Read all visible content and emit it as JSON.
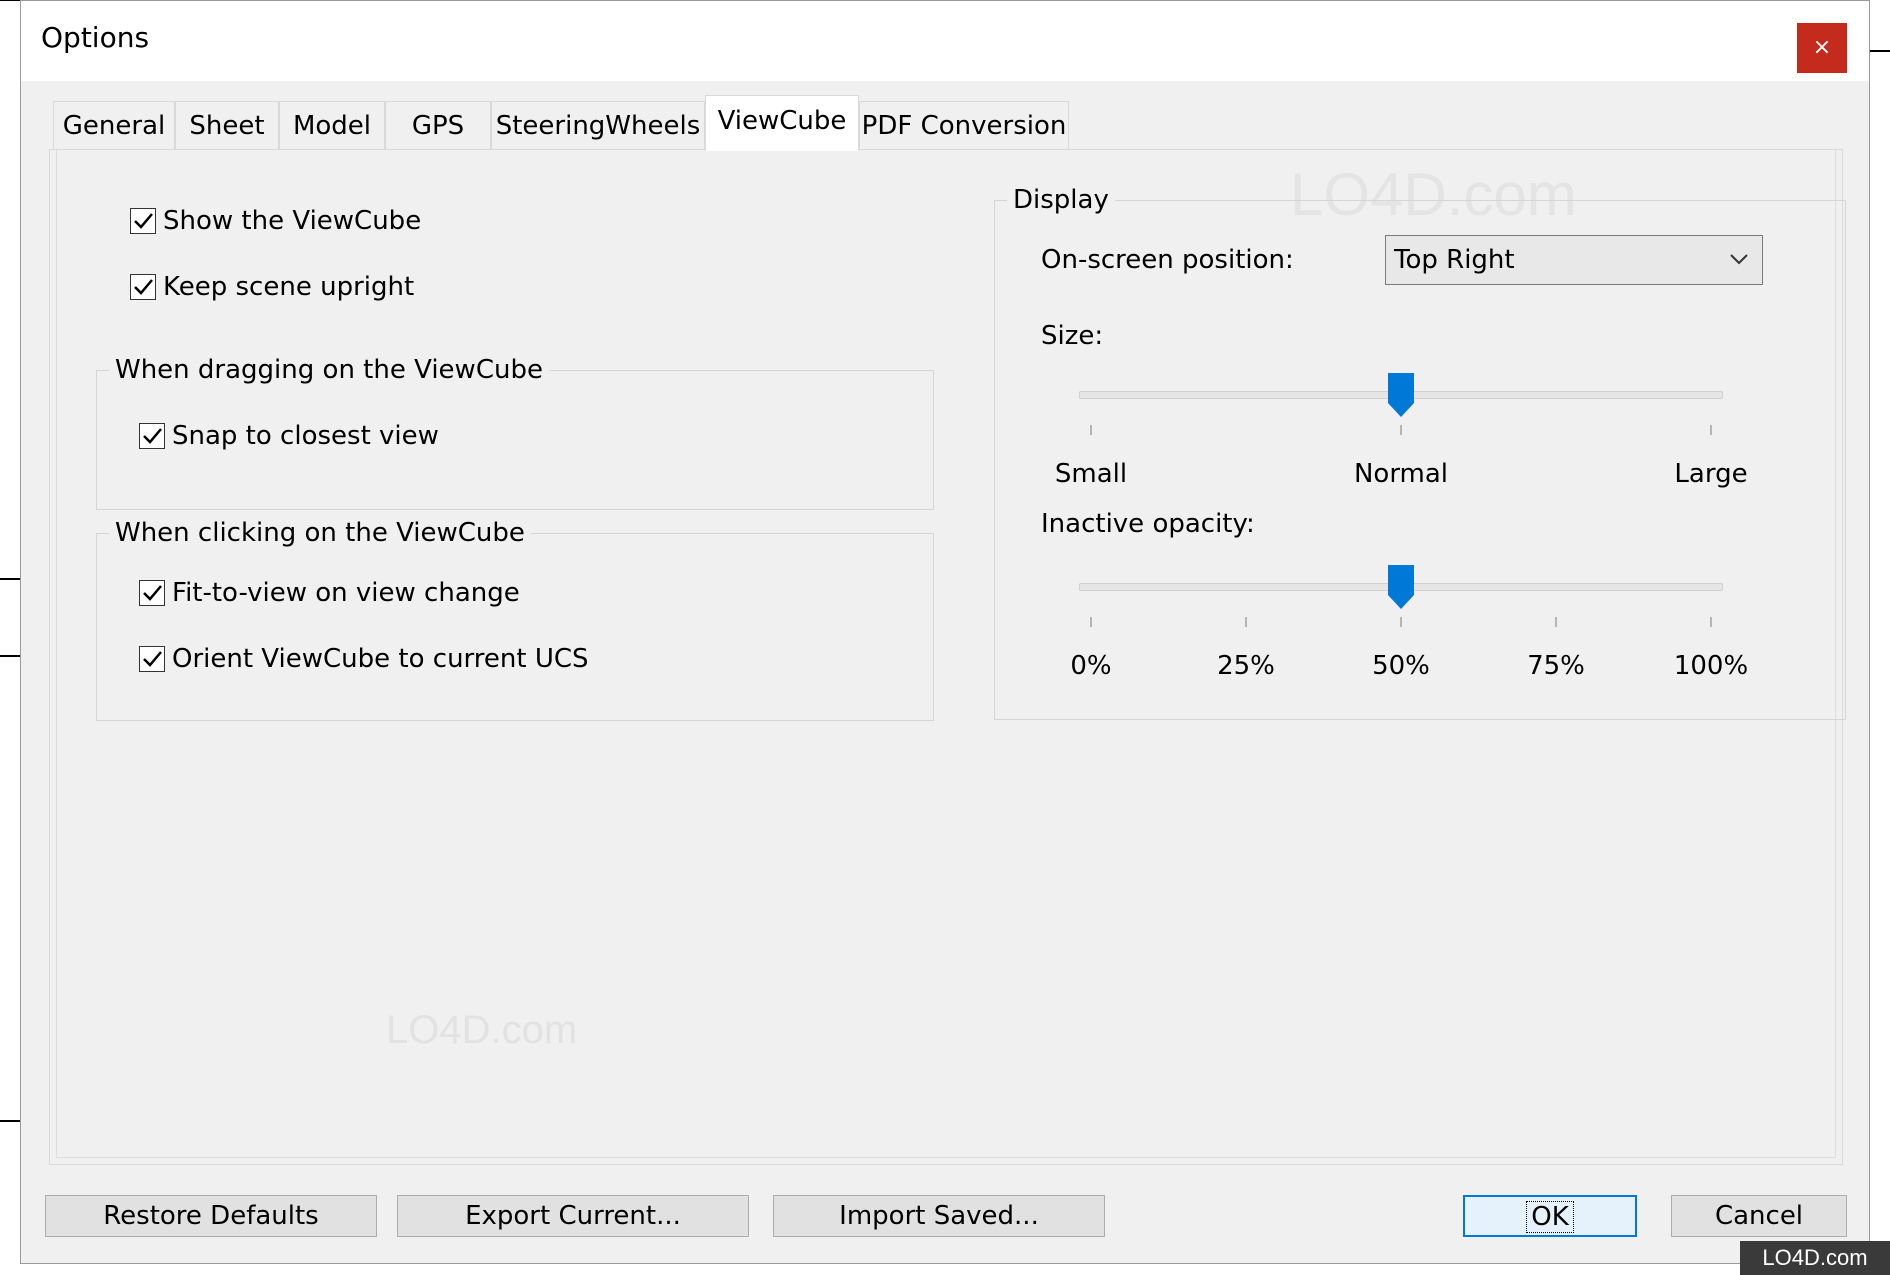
{
  "window": {
    "title": "Options",
    "close_glyph": "×"
  },
  "tabs": [
    {
      "label": "General",
      "active": false
    },
    {
      "label": "Sheet",
      "active": false
    },
    {
      "label": "Model",
      "active": false
    },
    {
      "label": "GPS",
      "active": false
    },
    {
      "label": "SteeringWheels",
      "active": false
    },
    {
      "label": "ViewCube",
      "active": true
    },
    {
      "label": "PDF Conversion",
      "active": false
    }
  ],
  "left": {
    "show_viewcube": {
      "label": "Show the ViewCube",
      "checked": true
    },
    "keep_upright": {
      "label": "Keep scene upright",
      "checked": true
    },
    "dragging_group": {
      "legend": "When dragging on the ViewCube",
      "snap": {
        "label": "Snap to closest view",
        "checked": true
      }
    },
    "clicking_group": {
      "legend": "When clicking on the ViewCube",
      "fit_to_view": {
        "label": "Fit-to-view on view change",
        "checked": true
      },
      "orient_ucs": {
        "label": "Orient ViewCube to current UCS",
        "checked": true
      }
    }
  },
  "display": {
    "legend": "Display",
    "position_label": "On-screen position:",
    "position_value": "Top Right",
    "size_label": "Size:",
    "size_value": "Normal",
    "size_ticks": [
      "Small",
      "Normal",
      "Large"
    ],
    "opacity_label": "Inactive opacity:",
    "opacity_value_percent": 50,
    "opacity_ticks": [
      "0%",
      "25%",
      "50%",
      "75%",
      "100%"
    ]
  },
  "buttons": {
    "restore": "Restore Defaults",
    "export": "Export Current...",
    "import": "Import Saved...",
    "ok": "OK",
    "cancel": "Cancel"
  },
  "watermark": {
    "text": "LO4D.com"
  },
  "colors": {
    "accent": "#0078d7",
    "close": "#c42b1c"
  },
  "icons": {
    "check": "check-icon",
    "chevron": "chevron-down-icon",
    "thumb": "slider-thumb-icon"
  }
}
